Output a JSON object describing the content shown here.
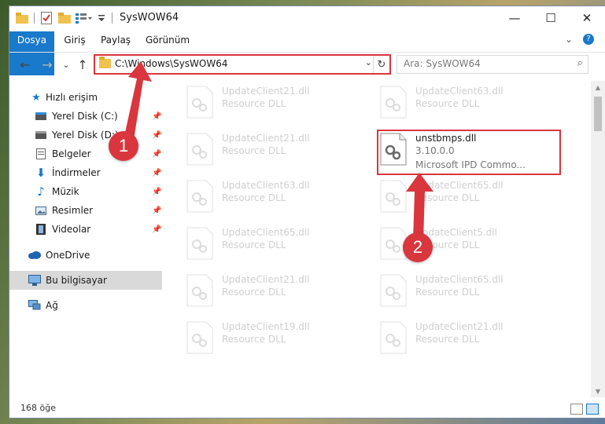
{
  "window": {
    "title": "SysWOW64",
    "controls": {
      "minimize": "—",
      "maximize": "☐",
      "close": "✕"
    }
  },
  "ribbon": {
    "tabs": [
      "Dosya",
      "Giriş",
      "Paylaş",
      "Görünüm"
    ],
    "expand": "⌄",
    "help": "?"
  },
  "nav": {
    "back": "←",
    "forward": "→",
    "recent": "⌄",
    "up": "↑",
    "address": "C:\\Windows\\SysWOW64",
    "address_dropdown": "⌄",
    "refresh": "↻",
    "search_placeholder": "Ara: SysWOW64",
    "search_icon": "⌕"
  },
  "sidebar": {
    "quick_access": "Hızlı erişim",
    "items": [
      {
        "label": "Yerel Disk (C:)",
        "icon": "drive-icon"
      },
      {
        "label": "Yerel Disk (D:)",
        "icon": "drive-icon"
      },
      {
        "label": "Belgeler",
        "icon": "documents-icon"
      },
      {
        "label": "İndirmeler",
        "icon": "downloads-icon"
      },
      {
        "label": "Müzik",
        "icon": "music-icon"
      },
      {
        "label": "Resimler",
        "icon": "pictures-icon"
      },
      {
        "label": "Videolar",
        "icon": "videos-icon"
      }
    ],
    "onedrive": "OneDrive",
    "this_pc": "Bu bilgisayar",
    "network": "Ağ"
  },
  "files": {
    "left": [
      {
        "name": "UpdateClient21.dll",
        "type": "Resource DLL"
      },
      {
        "name": "UpdateClient21.dll",
        "type": "Resource DLL"
      },
      {
        "name": "UpdateClient63.dll",
        "type": "Resource DLL"
      },
      {
        "name": "UpdateClient65.dll",
        "type": "Resource DLL"
      },
      {
        "name": "UpdateClient21.dll",
        "type": "Resource DLL"
      },
      {
        "name": "UpdateClient19.dll",
        "type": "Resource DLL"
      }
    ],
    "right": [
      {
        "name": "UpdateClient63.dll",
        "type": "Resource DLL"
      },
      {
        "name": "unstbmps.dll",
        "version": "3.10.0.0",
        "type": "Microsoft IPD Commo..."
      },
      {
        "name": "UpdateClient65.dll",
        "type": "Resource DLL"
      },
      {
        "name": "UpdateClient5.dll",
        "type": "Resource DLL"
      },
      {
        "name": "UpdateClient65.dll",
        "type": "Resource DLL"
      },
      {
        "name": "UpdateClient21.dll",
        "type": "Resource DLL"
      }
    ]
  },
  "status": {
    "count": "168 öğe"
  },
  "annotations": {
    "step1": "1",
    "step2": "2"
  },
  "colors": {
    "accent": "#1979ca",
    "highlight": "#d9363e"
  }
}
